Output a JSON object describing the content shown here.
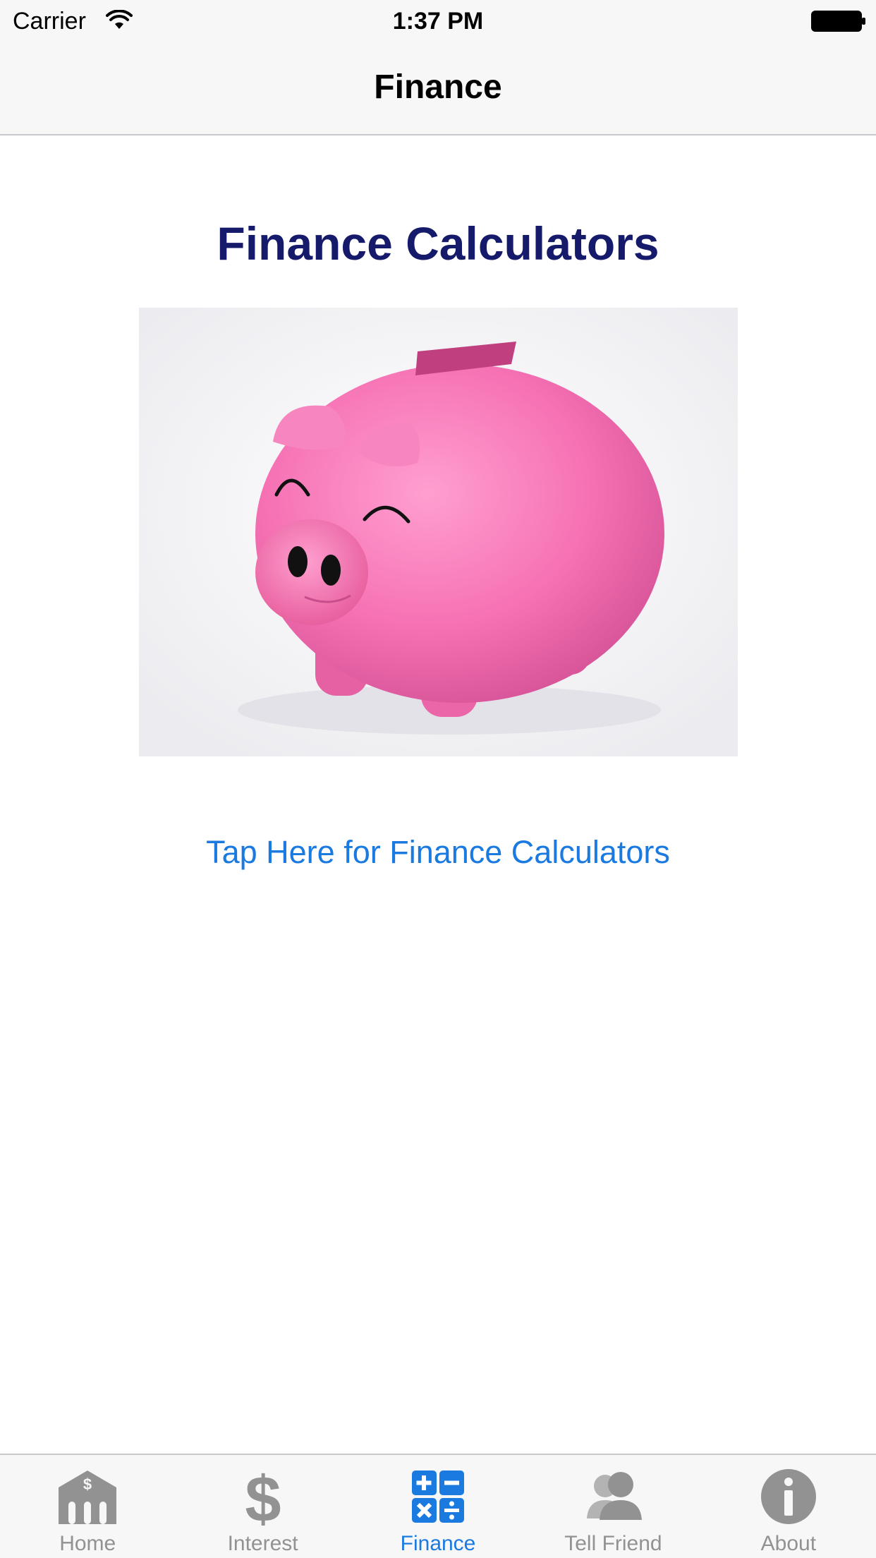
{
  "status_bar": {
    "carrier": "Carrier",
    "time": "1:37 PM",
    "icons": [
      "wifi-icon",
      "battery-icon"
    ]
  },
  "nav_bar": {
    "title": "Finance"
  },
  "main": {
    "heading": "Finance Calculators",
    "heading_color": "#161a6b",
    "image": "piggy-bank-image",
    "link_label": "Tap Here for Finance Calculators",
    "link_color": "#1a7ae0"
  },
  "tab_bar": {
    "active_color": "#1a7ae0",
    "inactive_color": "#929292",
    "selected": "Finance",
    "tabs": [
      {
        "label": "Home",
        "icon": "bank-icon"
      },
      {
        "label": "Interest",
        "icon": "dollar-icon"
      },
      {
        "label": "Finance",
        "icon": "calculator-icon"
      },
      {
        "label": "Tell Friend",
        "icon": "people-icon"
      },
      {
        "label": "About",
        "icon": "info-icon"
      }
    ]
  }
}
